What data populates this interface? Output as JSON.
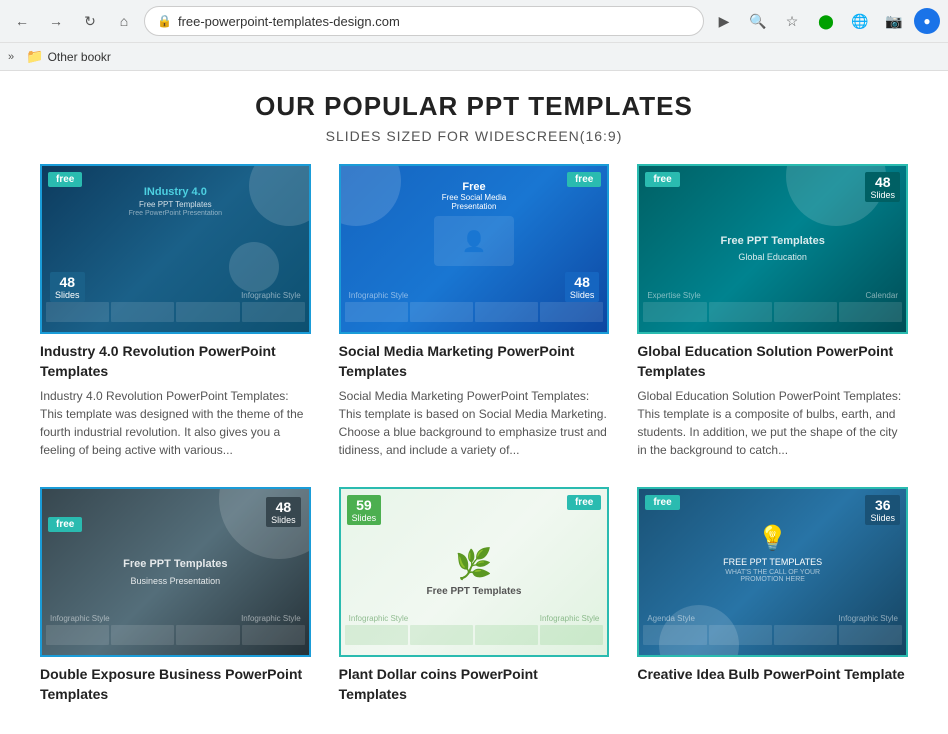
{
  "browser": {
    "url": "free-powerpoint-templates-design.com",
    "bookmarks_label": "Other bookr",
    "back_title": "Back",
    "forward_title": "Forward",
    "refresh_title": "Refresh",
    "home_title": "Home"
  },
  "page": {
    "title": "OUR POPULAR PPT TEMPLATES",
    "subtitle": "SLIDES SIZED FOR WIDESCREEN(16:9)"
  },
  "templates": [
    {
      "id": "t1",
      "name": "Industry 4.0 Revolution PowerPoint Templates",
      "description": "Industry 4.0 Revolution PowerPoint Templates: This template was designed with the theme of the fourth industrial revolution. It also gives you a feeling of being active with various...",
      "free_label": "free",
      "slides_count": "48",
      "slides_label": "Slides",
      "ppt_label": "Free PPT Templates"
    },
    {
      "id": "t2",
      "name": "Social Media Marketing PowerPoint Templates",
      "description": "Social Media Marketing PowerPoint Templates: This template is based on Social Media Marketing. Choose a blue background to emphasize trust and tidiness, and include a variety of...",
      "free_label": "free",
      "slides_count": "48",
      "slides_label": "Slides",
      "ppt_label": "Free Social Media Presentation"
    },
    {
      "id": "t3",
      "name": "Global Education Solution PowerPoint Templates",
      "description": "Global Education Solution PowerPoint Templates: This template is a composite of bulbs, earth, and students. In addition, we put the shape of the city in the background to catch...",
      "free_label": "free",
      "slides_count": "48",
      "slides_label": "Slides",
      "ppt_label": "Free PPT Templates"
    },
    {
      "id": "t4",
      "name": "Double Exposure Business PowerPoint Templates",
      "description": "",
      "free_label": "free",
      "slides_count": "48",
      "slides_label": "Slides",
      "ppt_label": "Free PPT Templates"
    },
    {
      "id": "t5",
      "name": "Plant Dollar coins PowerPoint Templates",
      "description": "",
      "free_label": "free",
      "slides_count": "59",
      "slides_label": "Slides",
      "ppt_label": "Free PPT Templates"
    },
    {
      "id": "t6",
      "name": "Creative Idea Bulb PowerPoint Template",
      "description": "",
      "free_label": "free",
      "slides_count": "36",
      "slides_label": "Slides",
      "ppt_label": "FREE PPT TEMPLATES"
    }
  ]
}
